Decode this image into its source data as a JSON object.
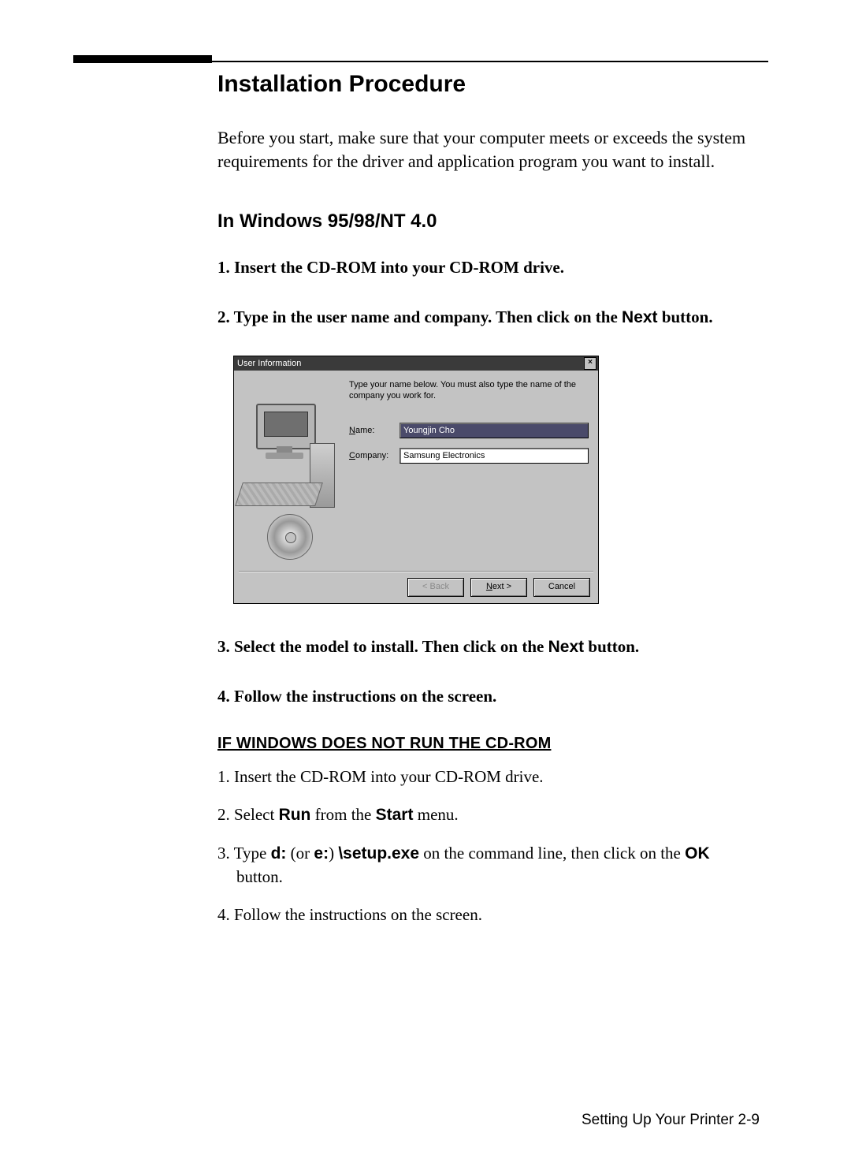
{
  "heading": "Installation Procedure",
  "intro": "Before you start, make sure that your computer meets or exceeds the system requirements for the driver and application program you want to install.",
  "subhead": "In Windows 95/98/NT 4.0",
  "steps": {
    "s1": "1. Insert the CD-ROM into your CD-ROM drive.",
    "s2a": "2. Type in the user name and company. Then click on the ",
    "s2b": "Next",
    "s2c": " button.",
    "s3a": "3. Select the model to install. Then click on the ",
    "s3b": "Next",
    "s3c": " button.",
    "s4": "4. Follow the instructions on the screen."
  },
  "dialog": {
    "title": "User Information",
    "close": "×",
    "instr": "Type your name below. You must also type the name of the company you work for.",
    "name_label_u": "N",
    "name_label_rest": "ame:",
    "name_value": "Youngjin Cho",
    "company_label_u": "C",
    "company_label_rest": "ompany:",
    "company_value": "Samsung Electronics",
    "back": "< Back",
    "next_u": "N",
    "next_rest": "ext >",
    "cancel": "Cancel"
  },
  "alt": {
    "heading": "IF WINDOWS DOES NOT RUN THE CD-ROM",
    "a1": "1. Insert the CD-ROM into your CD-ROM drive.",
    "a2a": "2. Select ",
    "a2b": "Run",
    "a2c": " from the ",
    "a2d": "Start",
    "a2e": " menu.",
    "a3a": "3. Type ",
    "a3b": "d:",
    "a3c": " (or ",
    "a3d": "e:",
    "a3e": ") ",
    "a3f": "\\setup.exe",
    "a3g": " on the command line, then click on the ",
    "a3h": "OK",
    "a3i": " button.",
    "a4": "4. Follow the instructions on the screen."
  },
  "footer": "Setting Up Your Printer  2-9"
}
